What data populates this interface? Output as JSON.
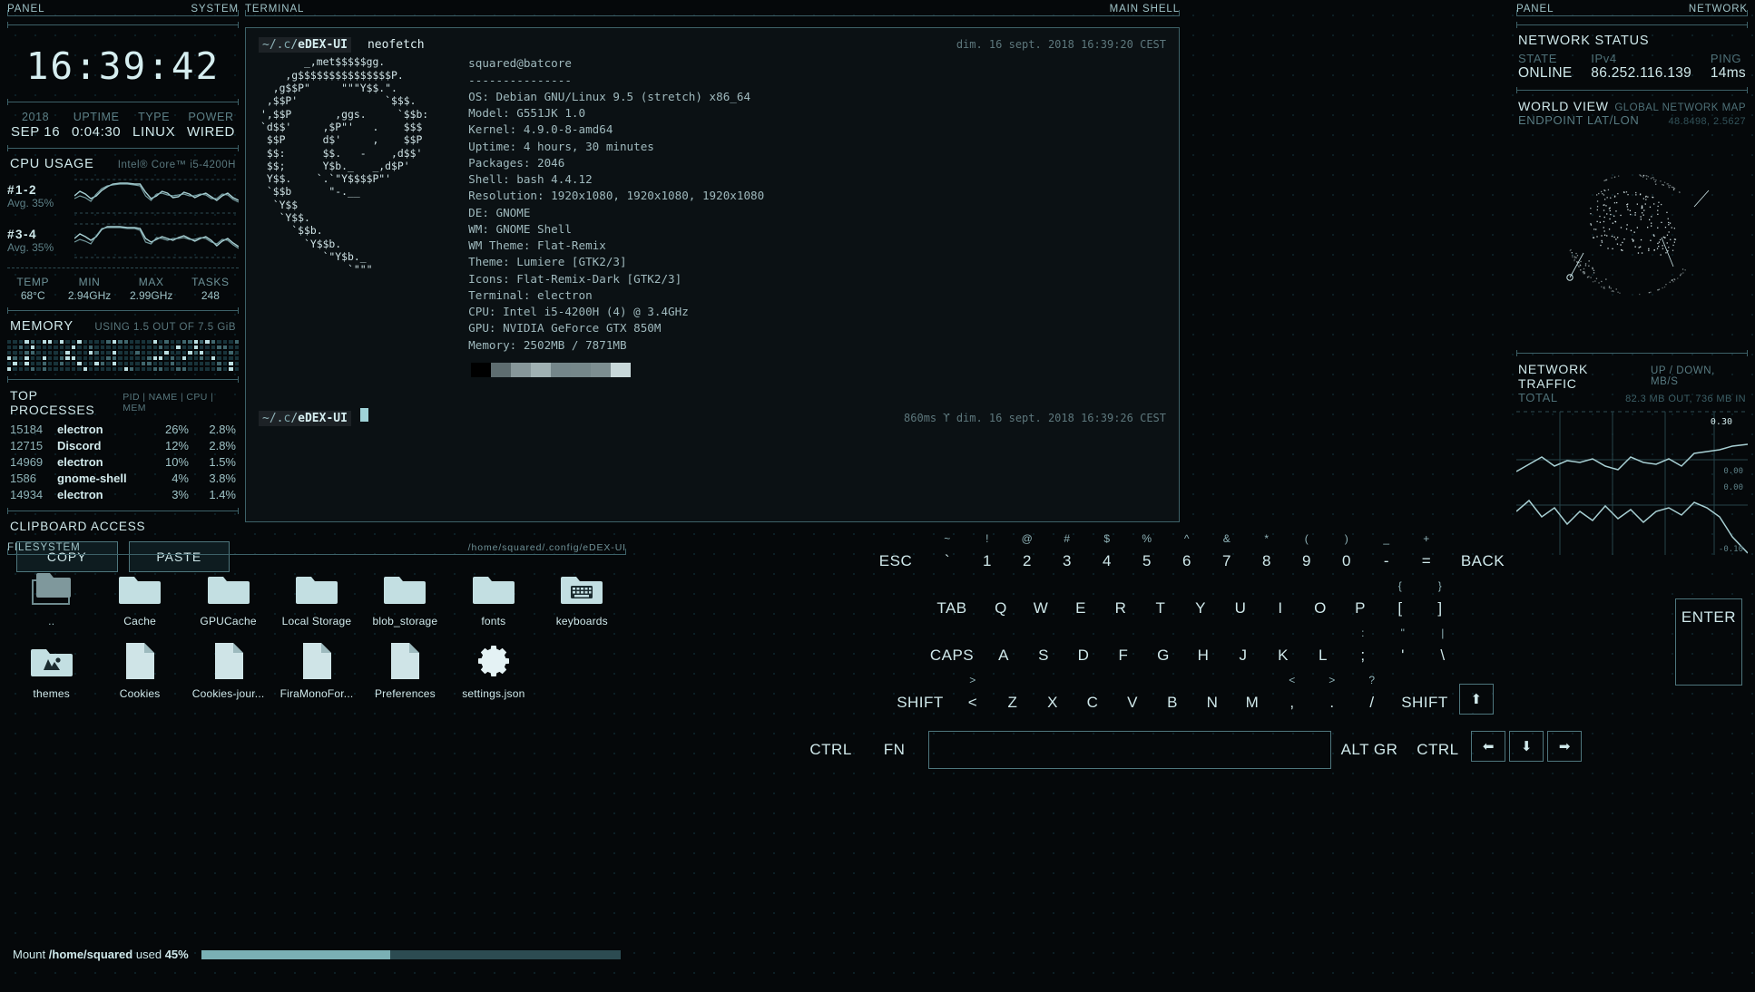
{
  "chrome": {
    "left_panel_tag": "PANEL",
    "left_panel_sub": "SYSTEM",
    "terminal_tag": "TERMINAL",
    "terminal_sub": "MAIN SHELL",
    "right_panel_tag": "PANEL",
    "right_panel_sub": "NETWORK",
    "filesystem_tag": "FILESYSTEM",
    "filesystem_path": "/home/squared/.config/eDEX-UI"
  },
  "clock": {
    "time": "16:39:42",
    "fields": [
      {
        "key": "2018",
        "value": "SEP 16"
      },
      {
        "key": "UPTIME",
        "value": "0:04:30"
      },
      {
        "key": "TYPE",
        "value": "LINUX"
      },
      {
        "key": "POWER",
        "value": "WIRED"
      }
    ]
  },
  "cpu": {
    "title": "CPU USAGE",
    "model": "Intel® Core™ i5-4200H",
    "cores": [
      {
        "label": "#1-2",
        "avg": "Avg. 35%"
      },
      {
        "label": "#3-4",
        "avg": "Avg. 35%"
      }
    ],
    "stats": [
      {
        "key": "TEMP",
        "value": "68°C"
      },
      {
        "key": "MIN",
        "value": "2.94GHz"
      },
      {
        "key": "MAX",
        "value": "2.99GHz"
      },
      {
        "key": "TASKS",
        "value": "248"
      }
    ]
  },
  "memory": {
    "title": "MEMORY",
    "usage": "USING 1.5 OUT OF 7.5 GiB"
  },
  "processes": {
    "title": "TOP PROCESSES",
    "columns": "PID | NAME | CPU | MEM",
    "rows": [
      {
        "pid": "15184",
        "name": "electron",
        "cpu": "26%",
        "mem": "2.8%"
      },
      {
        "pid": "12715",
        "name": "Discord",
        "cpu": "12%",
        "mem": "2.8%"
      },
      {
        "pid": "14969",
        "name": "electron",
        "cpu": "10%",
        "mem": "1.5%"
      },
      {
        "pid": "1586",
        "name": "gnome-shell",
        "cpu": "4%",
        "mem": "3.8%"
      },
      {
        "pid": "14934",
        "name": "electron",
        "cpu": "3%",
        "mem": "1.4%"
      }
    ]
  },
  "clipboard": {
    "title": "CLIPBOARD ACCESS",
    "copy_label": "COPY",
    "paste_label": "PASTE"
  },
  "terminal": {
    "prompt_tilde": "~/.",
    "prompt_c": "c",
    "prompt_slash": "/",
    "prompt_dir": "eDEX-UI",
    "command": "neofetch",
    "timestamp_top": "dim. 16 sept. 2018 16:39:20 CEST",
    "timestamp_bottom": "860ms ϒ dim. 16 sept. 2018 16:39:26 CEST",
    "ascii_art": "       _,met$$$$$gg.\n    ,g$$$$$$$$$$$$$$$P.\n  ,g$$P\"     \"\"\"Y$$.\".\n ,$$P'              `$$$.\n',$$P       ,ggs.     `$$b:\n`d$$'     ,$P\"'   .    $$$\n $$P      d$'     ,    $$P\n $$:      $$.   -    ,d$$'\n $$;      Y$b._   _,d$P'\n Y$$.    `.`\"Y$$$$P\"'\n `$$b      \"-.__\n  `Y$$\n   `Y$$.\n     `$$b.\n       `Y$$b.\n          `\"Y$b._\n              `\"\"\"",
    "neofetch_header": "squared@batcore",
    "neofetch_rule": "---------------",
    "neofetch_lines": [
      "OS: Debian GNU/Linux 9.5 (stretch) x86_64",
      "Model: G551JK 1.0",
      "Kernel: 4.9.0-8-amd64",
      "Uptime: 4 hours, 30 minutes",
      "Packages: 2046",
      "Shell: bash 4.4.12",
      "Resolution: 1920x1080, 1920x1080, 1920x1080",
      "DE: GNOME",
      "WM: GNOME Shell",
      "WM Theme: Flat-Remix",
      "Theme: Lumiere [GTK2/3]",
      "Icons: Flat-Remix-Dark [GTK2/3]",
      "Terminal: electron",
      "CPU: Intel i5-4200H (4) @ 3.4GHz",
      "GPU: NVIDIA GeForce GTX 850M",
      "Memory: 2502MB / 7871MB"
    ],
    "swatches": [
      "#000000",
      "#5e6d70",
      "#87979a",
      "#a0b1b3",
      "#74868a",
      "#75878a",
      "#7d8e91",
      "#c8d8da"
    ]
  },
  "network": {
    "status_title": "NETWORK STATUS",
    "state_key": "STATE",
    "state_value": "ONLINE",
    "ipv4_key": "IPv4",
    "ipv4_value": "86.252.116.139",
    "ping_key": "PING",
    "ping_value": "14ms",
    "world_view": "WORLD VIEW",
    "world_view_sub": "GLOBAL NETWORK MAP",
    "endpoint_key": "ENDPOINT LAT/LON",
    "endpoint_value": "48.8498, 2.5627",
    "traffic_title": "NETWORK TRAFFIC",
    "traffic_units": "UP / DOWN, MB/S",
    "total_key": "TOTAL",
    "total_value": "82.3 MB OUT, 736 MB IN",
    "axis_top": "0.30",
    "axis_mid": "0.00",
    "axis_mid2": "0.00",
    "axis_bottom": "-0.10"
  },
  "filesystem": {
    "items": [
      {
        "label": "..",
        "icon": "folder-up-icon",
        "type": "updir"
      },
      {
        "label": "Cache",
        "icon": "folder-icon",
        "type": "folder"
      },
      {
        "label": "GPUCache",
        "icon": "folder-icon",
        "type": "folder"
      },
      {
        "label": "Local Storage",
        "icon": "folder-icon",
        "type": "folder"
      },
      {
        "label": "blob_storage",
        "icon": "folder-icon",
        "type": "folder"
      },
      {
        "label": "fonts",
        "icon": "folder-icon",
        "type": "folder"
      },
      {
        "label": "keyboards",
        "icon": "keyboard-folder-icon",
        "type": "folder-kb"
      },
      {
        "label": "themes",
        "icon": "theme-folder-icon",
        "type": "folder-th"
      },
      {
        "label": "Cookies",
        "icon": "file-icon",
        "type": "file"
      },
      {
        "label": "Cookies-jour...",
        "icon": "file-icon",
        "type": "file"
      },
      {
        "label": "FiraMonoFor...",
        "icon": "file-icon",
        "type": "file"
      },
      {
        "label": "Preferences",
        "icon": "file-icon",
        "type": "file"
      },
      {
        "label": "settings.json",
        "icon": "gear-icon",
        "type": "settings"
      }
    ],
    "mount_prefix": "Mount",
    "mount_path": "/home/squared",
    "mount_suffix": "used",
    "mount_percent": "45%",
    "mount_fill": 45
  },
  "keyboard": {
    "rows": [
      [
        {
          "main": "ESC",
          "w": "wide"
        },
        {
          "main": "`",
          "alt": "~"
        },
        {
          "main": "1",
          "alt": "!"
        },
        {
          "main": "2",
          "alt": "@"
        },
        {
          "main": "3",
          "alt": "#"
        },
        {
          "main": "4",
          "alt": "$"
        },
        {
          "main": "5",
          "alt": "%"
        },
        {
          "main": "6",
          "alt": "^"
        },
        {
          "main": "7",
          "alt": "&"
        },
        {
          "main": "8",
          "alt": "*"
        },
        {
          "main": "9",
          "alt": "("
        },
        {
          "main": "0",
          "alt": ")"
        },
        {
          "main": "-",
          "alt": "_"
        },
        {
          "main": "=",
          "alt": "+"
        },
        {
          "main": "BACK",
          "w": "back"
        }
      ],
      [
        {
          "main": "TAB",
          "w": "tab"
        },
        {
          "main": "Q"
        },
        {
          "main": "W"
        },
        {
          "main": "E"
        },
        {
          "main": "R"
        },
        {
          "main": "T"
        },
        {
          "main": "Y"
        },
        {
          "main": "U"
        },
        {
          "main": "I"
        },
        {
          "main": "O"
        },
        {
          "main": "P"
        },
        {
          "main": "[",
          "alt": "{"
        },
        {
          "main": "]",
          "alt": "}"
        }
      ],
      [
        {
          "main": "CAPS",
          "w": "caps"
        },
        {
          "main": "A"
        },
        {
          "main": "S"
        },
        {
          "main": "D"
        },
        {
          "main": "F"
        },
        {
          "main": "G"
        },
        {
          "main": "H"
        },
        {
          "main": "J"
        },
        {
          "main": "K"
        },
        {
          "main": "L"
        },
        {
          "main": ";",
          "alt": ":"
        },
        {
          "main": "'",
          "alt": "\""
        },
        {
          "main": "\\",
          "alt": "|"
        }
      ],
      [
        {
          "main": "SHIFT",
          "w": "shift"
        },
        {
          "main": "<",
          "alt": ">"
        },
        {
          "main": "Z"
        },
        {
          "main": "X"
        },
        {
          "main": "C"
        },
        {
          "main": "V"
        },
        {
          "main": "B"
        },
        {
          "main": "N"
        },
        {
          "main": "M"
        },
        {
          "main": ",",
          "alt": "<"
        },
        {
          "main": ".",
          "alt": ">"
        },
        {
          "main": "/",
          "alt": "?"
        },
        {
          "main": "SHIFT",
          "w": "shift"
        },
        {
          "main": "⬆",
          "w": "boxed"
        }
      ],
      [
        {
          "main": "CTRL",
          "w": "wide"
        },
        {
          "main": "FN",
          "w": "wide"
        },
        {
          "main": "",
          "w": "space"
        },
        {
          "main": "ALT GR",
          "w": "wide"
        },
        {
          "main": "CTRL",
          "w": "wide"
        },
        {
          "main": "⬅",
          "w": "boxed"
        },
        {
          "main": "⬇",
          "w": "boxed"
        },
        {
          "main": "➡",
          "w": "boxed"
        }
      ]
    ],
    "enter_label": "ENTER"
  }
}
